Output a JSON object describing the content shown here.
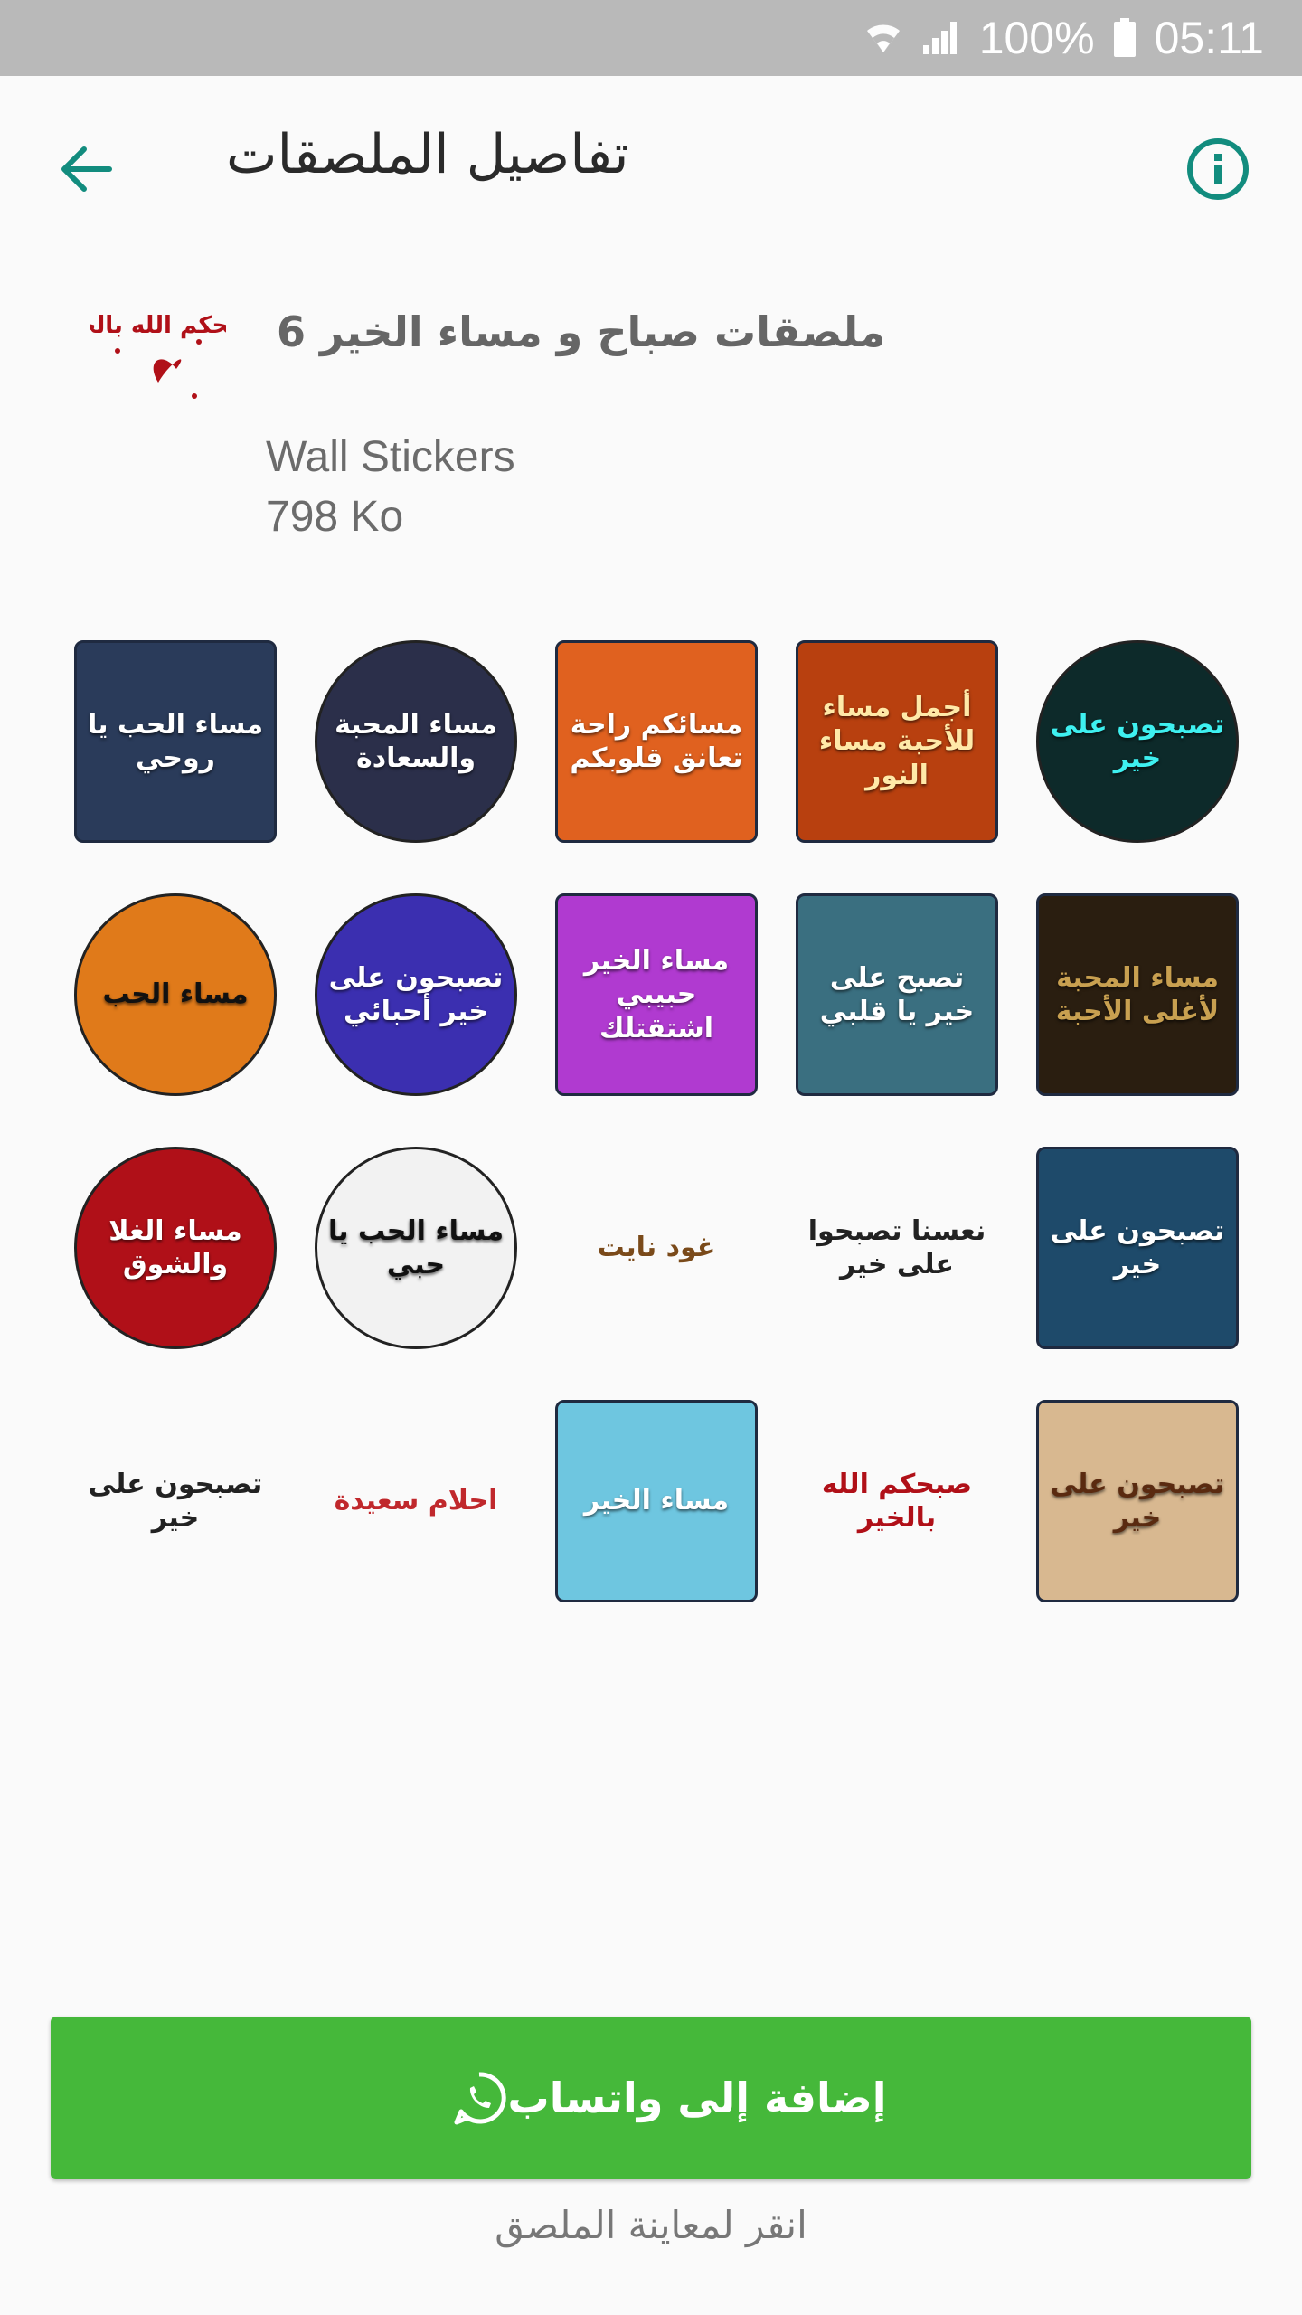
{
  "status_bar": {
    "battery": "100%",
    "time": "05:11"
  },
  "toolbar": {
    "title": "تفاصيل الملصقات",
    "back_icon": "arrow-back-icon",
    "info_icon": "info-icon"
  },
  "pack": {
    "name": "ملصقات صباح و مساء الخير 6",
    "publisher": "Wall Stickers",
    "size": "798 Ko",
    "tray_text": "صبحكم الله بالخير"
  },
  "colors": {
    "accent": "#128c7e",
    "button": "#45b83a"
  },
  "stickers": [
    {
      "text": "مساء الحب يا روحي",
      "bg": "#2a3b5a",
      "fg": "#ffffff",
      "shape": "square"
    },
    {
      "text": "مساء المحبة والسعادة",
      "bg": "#2b2f4a",
      "fg": "#ffffff",
      "shape": "circle"
    },
    {
      "text": "مسائكم راحة تعانق قلوبكم",
      "bg": "#e0611f",
      "fg": "#ffffff",
      "shape": "square"
    },
    {
      "text": "أجمل مساء للأحبة مساء النور",
      "bg": "#b8400f",
      "fg": "#ffe9a8",
      "shape": "square"
    },
    {
      "text": "تصبحون على خير",
      "bg": "#0d2a2a",
      "fg": "#3ef0f0",
      "shape": "circle"
    },
    {
      "text": "مساء الحب",
      "bg": "#e07a1a",
      "fg": "#111111",
      "shape": "circle"
    },
    {
      "text": "تصبحون على خير أحبائي",
      "bg": "#3b2fb0",
      "fg": "#ffffff",
      "shape": "circle"
    },
    {
      "text": "مساء الخير حبيبي اشتقتلك",
      "bg": "#b03ad0",
      "fg": "#ffffff",
      "shape": "square"
    },
    {
      "text": "تصبح على خير يا قلبي",
      "bg": "#3a6f80",
      "fg": "#ffffff",
      "shape": "square"
    },
    {
      "text": "مساء المحبة لأغلى الأحبة",
      "bg": "#2a1e10",
      "fg": "#c8a050",
      "shape": "square"
    },
    {
      "text": "مساء الغلا والشوق",
      "bg": "#b01018",
      "fg": "#ffffff",
      "shape": "circle"
    },
    {
      "text": "مساء الحب يا حبي",
      "bg": "#f2f2f2",
      "fg": "#111111",
      "shape": "circle"
    },
    {
      "text": "غود نايت",
      "bg": "#fafafa",
      "fg": "#7a4a1a",
      "shape": "none"
    },
    {
      "text": "نعسنا تصبحوا على خير",
      "bg": "#fafafa",
      "fg": "#222222",
      "shape": "none"
    },
    {
      "text": "تصبحون على خير",
      "bg": "#1e4a6a",
      "fg": "#ffffff",
      "shape": "square"
    },
    {
      "text": "تصبحون على خير",
      "bg": "#fafafa",
      "fg": "#222222",
      "shape": "none"
    },
    {
      "text": "احلام سعيدة",
      "bg": "#fafafa",
      "fg": "#c0282c",
      "shape": "none"
    },
    {
      "text": "مساء الخير",
      "bg": "#6ec6e0",
      "fg": "#ffffff",
      "shape": "square"
    },
    {
      "text": "صبحكم الله بالخير",
      "bg": "#fafafa",
      "fg": "#b01018",
      "shape": "none"
    },
    {
      "text": "تصبحون على خير",
      "bg": "#d8b890",
      "fg": "#5a2a10",
      "shape": "square"
    }
  ],
  "actions": {
    "add_label": "إضافة إلى واتساب",
    "add_icon": "whatsapp-icon",
    "preview_hint": "انقر لمعاينة الملصق"
  }
}
